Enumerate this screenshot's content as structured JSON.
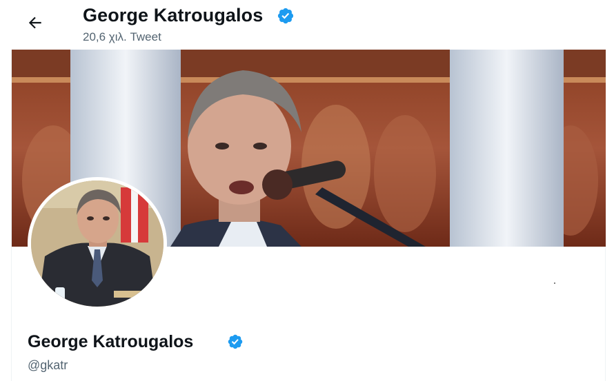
{
  "header": {
    "name": "George Katrougalos",
    "tweet_count": "20,6 χιλ. Tweet",
    "back_icon": "arrow-left-icon",
    "verified_icon": "verified-badge-icon"
  },
  "profile": {
    "name": "George Katrougalos",
    "handle": "@gkatr",
    "verified_icon": "verified-badge-icon"
  },
  "colors": {
    "verified_blue": "#1d9bf0",
    "secondary_text": "#536471",
    "primary_text": "#0f1419"
  }
}
